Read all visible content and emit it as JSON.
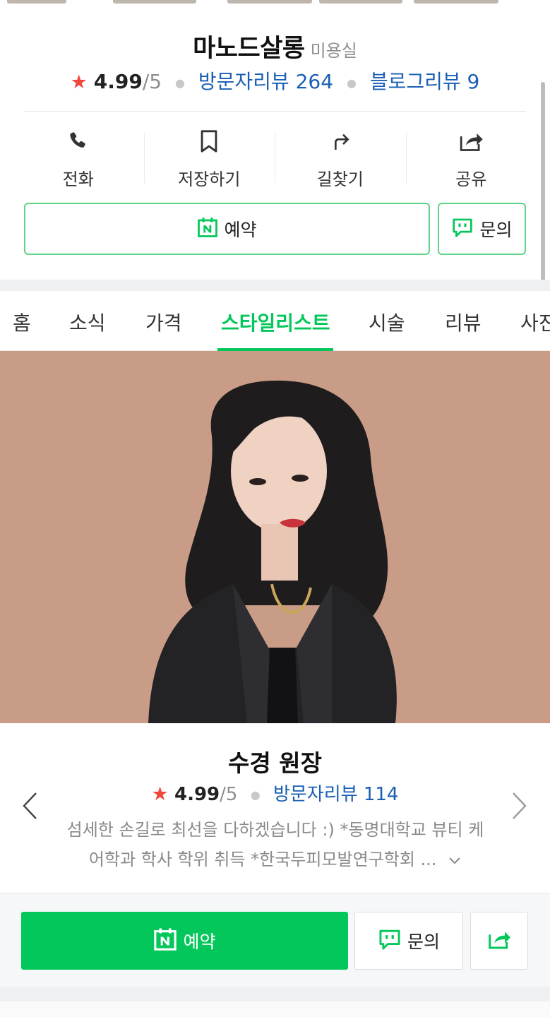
{
  "place": {
    "name": "마노드살롱",
    "category": "미용실",
    "rating": "4.99",
    "rating_max": "/5",
    "visitor_reviews": "방문자리뷰 264",
    "blog_reviews": "블로그리뷰 9"
  },
  "actions": [
    {
      "label": "전화",
      "icon": "phone-icon"
    },
    {
      "label": "저장하기",
      "icon": "bookmark-icon"
    },
    {
      "label": "길찾기",
      "icon": "directions-icon"
    },
    {
      "label": "공유",
      "icon": "share-icon"
    }
  ],
  "buttons": {
    "reserve": "예약",
    "inquiry": "문의"
  },
  "tabs": [
    {
      "label": "홈"
    },
    {
      "label": "소식"
    },
    {
      "label": "가격"
    },
    {
      "label": "스타일리스트",
      "active": true
    },
    {
      "label": "시술"
    },
    {
      "label": "리뷰"
    },
    {
      "label": "사진"
    }
  ],
  "stylist": {
    "name": "수경 원장",
    "rating": "4.99",
    "rating_max": "/5",
    "visitor_reviews": "방문자리뷰 114",
    "description_line1": "섬세한 손길로 최선을 다하겠습니다 :) *동명대학교 뷰티 케",
    "description_line2": "어학과 학사 학위 취득 *한국두피모발연구학회 ..."
  },
  "bottom_bar": {
    "reserve": "예약",
    "inquiry": "문의"
  },
  "colors": {
    "naver_green": "#03c75a",
    "link_blue": "#1a5fb4",
    "star_red": "#f0473c",
    "photo_bg": "#c99c87"
  }
}
